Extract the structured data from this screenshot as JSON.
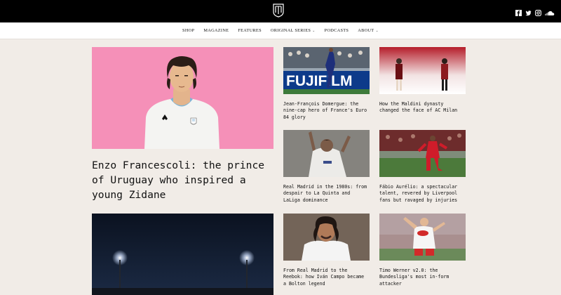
{
  "social": {
    "icons": [
      "facebook-icon",
      "twitter-icon",
      "instagram-icon",
      "soundcloud-icon"
    ]
  },
  "nav": {
    "shop": "SHOP",
    "magazine": "MAGAZINE",
    "features": "FEATURES",
    "original_series": "ORIGINAL SERIES",
    "podcasts": "PODCASTS",
    "about": "ABOUT"
  },
  "hero": {
    "title": "Enzo Francescoli: the prince of Uruguay who inspired a young Zidane"
  },
  "cards": [
    {
      "title": "Jean-François Domergue: the nine-cap hero of France's Euro 84 glory",
      "image_text": "FUJIFILM"
    },
    {
      "title": "How the Maldini dynasty changed the face of AC Milan"
    },
    {
      "title": "Real Madrid in the 1980s: from despair to La Quinta and LaLiga dominance"
    },
    {
      "title": "Fábio Aurélio: a spectacular talent, revered by Liverpool fans but ravaged by injuries"
    },
    {
      "title": "From Real Madrid to the Reebok: how Iván Campo became a Bolton legend"
    },
    {
      "title": "Timo Werner v2.0: the Bundesliga's most in-form attacker"
    }
  ],
  "colors": {
    "topbar": "#000000",
    "background": "#f1ece7",
    "hero_bg": "#f590b8"
  }
}
